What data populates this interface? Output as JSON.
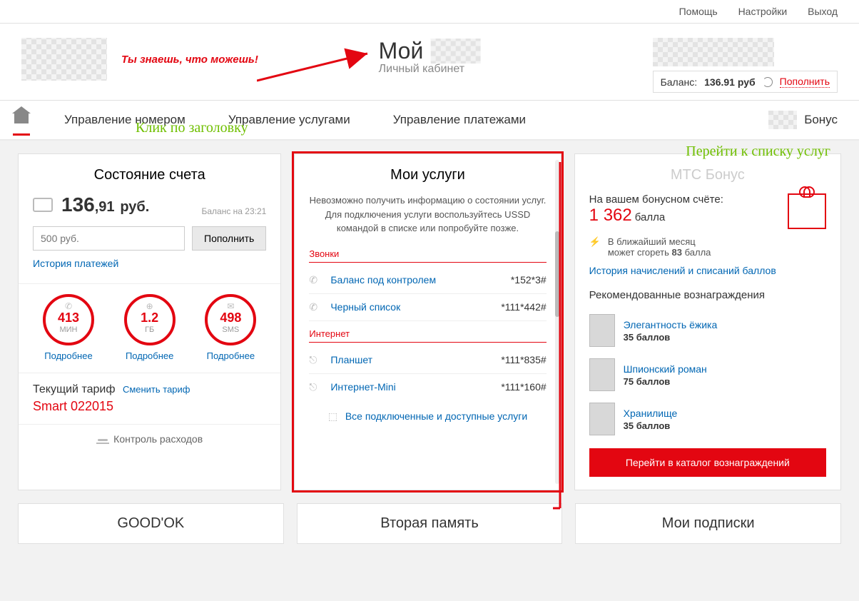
{
  "topbar": {
    "help": "Помощь",
    "settings": "Настройки",
    "exit": "Выход"
  },
  "header": {
    "slogan": "Ты знаешь, что можешь!",
    "title": "Мой",
    "subtitle": "Личный кабинет",
    "balance_label": "Баланс:",
    "balance_value": "136.91",
    "balance_currency": "руб",
    "topup": "Пополнить"
  },
  "annotations": {
    "click_title": "Клик по заголовку",
    "go_services": "Перейти к списку услуг"
  },
  "nav": {
    "number": "Управление номером",
    "services": "Управление услугами",
    "payments": "Управление платежами",
    "bonus": "Бонус"
  },
  "account": {
    "title": "Состояние счета",
    "int": "136",
    "dec": ",91",
    "cur": "руб.",
    "asof": "Баланс на 23:21",
    "placeholder": "500 руб.",
    "topup_btn": "Пополнить",
    "history": "История платежей",
    "gauges": [
      {
        "icon": "phone",
        "value": "413",
        "unit": "МИН",
        "link": "Подробнее"
      },
      {
        "icon": "globe",
        "value": "1.2",
        "unit": "ГБ",
        "link": "Подробнее"
      },
      {
        "icon": "mail",
        "value": "498",
        "unit": "SMS",
        "link": "Подробнее"
      }
    ],
    "tariff_label": "Текущий тариф",
    "change": "Сменить тариф",
    "tariff_name": "Smart 022015",
    "expense": "Контроль расходов"
  },
  "services": {
    "title": "Мои услуги",
    "msg": "Невозможно получить информацию о состоянии услуг. Для подключения услуги воспользуйтесь USSD командой в списке или попробуйте позже.",
    "cat_calls": "Звонки",
    "cat_inet": "Интернет",
    "items_calls": [
      {
        "name": "Баланс под контролем",
        "code": "*152*3#"
      },
      {
        "name": "Черный список",
        "code": "*111*442#"
      }
    ],
    "items_inet": [
      {
        "name": "Планшет",
        "code": "*111*835#"
      },
      {
        "name": "Интернет-Mini",
        "code": "*111*160#"
      }
    ],
    "all": "Все подключенные и доступные услуги"
  },
  "bonus": {
    "title": "МТС Бонус",
    "on_account": "На вашем бонусном счёте:",
    "points": "1 362",
    "points_unit": "балла",
    "burn_text1": "В ближайший месяц",
    "burn_text2": "может сгореть",
    "burn_pts": "83",
    "burn_unit": "балла",
    "history": "История начислений и списаний баллов",
    "rec_title": "Рекомендованные вознаграждения",
    "rewards": [
      {
        "name": "Элегантность ёжика",
        "cost": "35 баллов"
      },
      {
        "name": "Шпионский роман",
        "cost": "75 баллов"
      },
      {
        "name": "Хранилище",
        "cost": "35 баллов"
      }
    ],
    "catalog_btn": "Перейти в каталог вознаграждений"
  },
  "bottom": {
    "goodok": "GOOD'OK",
    "memory": "Вторая память",
    "subs": "Мои подписки"
  }
}
